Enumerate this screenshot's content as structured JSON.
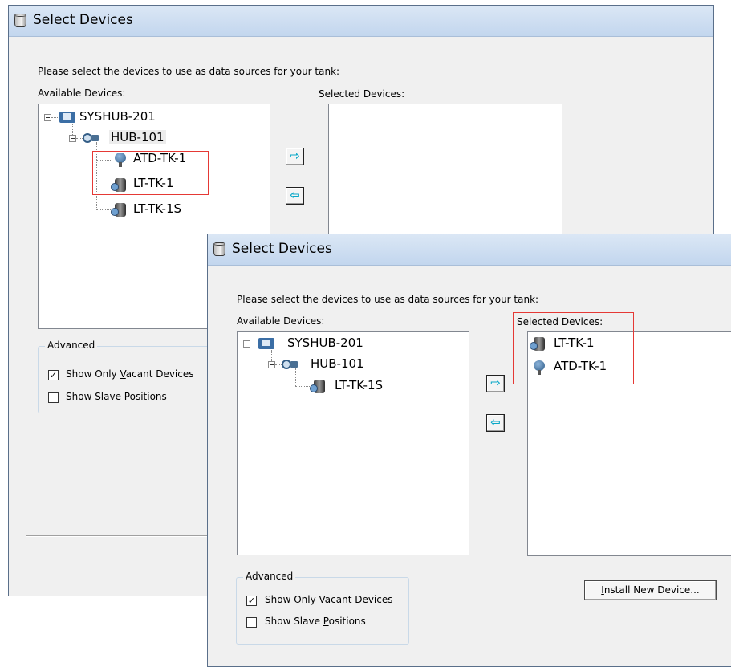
{
  "back_dialog": {
    "title": "Select Devices",
    "instruction": "Please select the devices to use as data sources for your tank:",
    "available_label": "Available Devices:",
    "selected_label": "Selected Devices:",
    "tree": {
      "root": "SYSHUB-201",
      "hub": "HUB-101",
      "devices": [
        "ATD-TK-1",
        "LT-TK-1",
        "LT-TK-1S"
      ]
    },
    "advanced": {
      "title": "Advanced",
      "vacant_pre": "Show Only ",
      "vacant_key": "V",
      "vacant_post": "acant Devices",
      "vacant_checked": true,
      "slave_pre": "Show Slave ",
      "slave_key": "P",
      "slave_post": "ositions",
      "slave_checked": false
    }
  },
  "front_dialog": {
    "title": "Select Devices",
    "instruction": "Please select the devices to use as data sources for your tank:",
    "available_label": "Available Devices:",
    "selected_label": "Selected Devices:",
    "tree": {
      "root": "SYSHUB-201",
      "hub": "HUB-101",
      "devices": [
        "LT-TK-1S"
      ]
    },
    "selected": [
      "LT-TK-1",
      "ATD-TK-1"
    ],
    "advanced": {
      "title": "Advanced",
      "vacant_pre": "Show Only ",
      "vacant_key": "V",
      "vacant_post": "acant Devices",
      "vacant_checked": true,
      "slave_pre": "Show Slave ",
      "slave_key": "P",
      "slave_post": "ositions",
      "slave_checked": false
    },
    "install_pre": "",
    "install_key": "I",
    "install_post": "nstall New Device..."
  },
  "buttons": {
    "add": "⇨",
    "remove": "⇦",
    "check": "✓"
  },
  "colors": {
    "highlight_box": "#e53935",
    "arrow": "#0aa8c8",
    "titlebar": "#c9daf0"
  },
  "icons": {
    "window": "tank-icon",
    "root": "system-hub-icon",
    "hub": "hub-icon",
    "atd": "temperature-sensor-icon",
    "lt": "level-transmitter-icon"
  }
}
